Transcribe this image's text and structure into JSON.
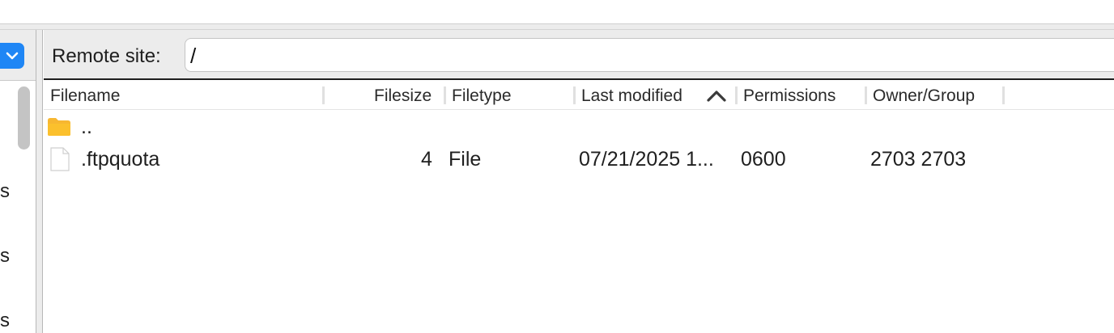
{
  "left_pane": {
    "partial_letters": [
      "s",
      "s",
      "s"
    ]
  },
  "remote": {
    "label": "Remote site:",
    "path": "/"
  },
  "columns": {
    "filename": "Filename",
    "filesize": "Filesize",
    "filetype": "Filetype",
    "last_modified": "Last modified",
    "permissions": "Permissions",
    "owner_group": "Owner/Group"
  },
  "sort": {
    "column": "Last modified",
    "direction": "ascending"
  },
  "files": [
    {
      "name": "..",
      "icon": "folder-icon",
      "size": "",
      "type": "",
      "modified": "",
      "permissions": "",
      "owner": ""
    },
    {
      "name": ".ftpquota",
      "icon": "file-icon",
      "size": "4",
      "type": "File",
      "modified": "07/21/2025 1...",
      "permissions": "0600",
      "owner": "2703 2703"
    }
  ],
  "colors": {
    "accent": "#1f86f5",
    "folder": "#f7b731",
    "header_bg": "#ececec"
  }
}
